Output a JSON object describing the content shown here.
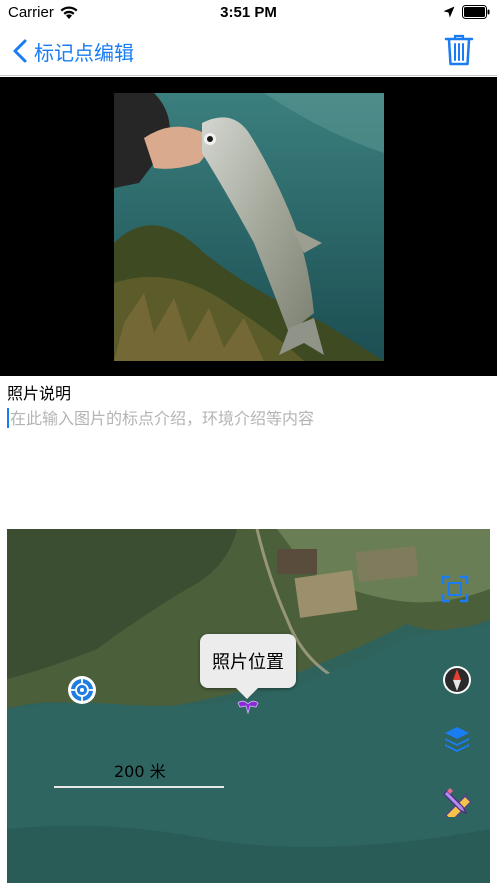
{
  "status_bar": {
    "carrier": "Carrier",
    "time": "3:51 PM",
    "icons": [
      "wifi-icon",
      "location-arrow-icon",
      "battery-icon"
    ]
  },
  "nav": {
    "back_label": "标记点编辑",
    "back_icon": "chevron-left-icon",
    "delete_icon": "trash-icon",
    "accent_color": "#1a7cf2"
  },
  "photo": {
    "description": "photo of a hand holding a silver fish over a lake"
  },
  "description": {
    "label": "照片说明",
    "placeholder": "在此输入图片的标点介绍，环境介绍等内容",
    "value": ""
  },
  "map": {
    "callout_label": "照片位置",
    "scale_label": "200 米",
    "icons": [
      "locate-icon",
      "fullscreen-icon",
      "compass-icon",
      "layers-icon",
      "measure-icon",
      "photo-marker-icon"
    ]
  }
}
